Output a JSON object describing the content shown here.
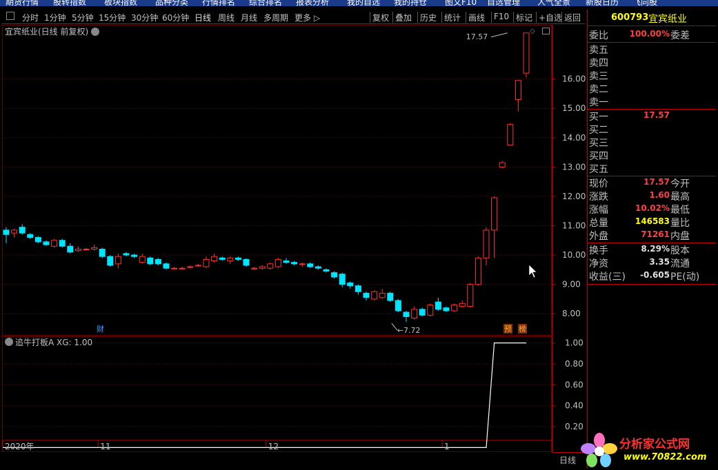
{
  "menubar": [
    "期货行情",
    "股转指数",
    "板块指数",
    "品种分类",
    "行情排名",
    "综合排名",
    "报表分析",
    "我的自选",
    "我的持仓",
    "图文F10",
    "自选管理",
    "人气全景",
    "新股日历",
    "飞向股"
  ],
  "toolbar": {
    "periods": [
      "分时",
      "1分钟",
      "5分钟",
      "15分钟",
      "30分钟",
      "60分钟",
      "日线",
      "周线",
      "月线",
      "多周期",
      "更多 ▷"
    ],
    "active_period": "日线",
    "right_buttons": [
      "复权",
      "叠加",
      "历史",
      "统计",
      "画线",
      "F10",
      "标记",
      "+自选",
      "返回"
    ]
  },
  "chart_title": "宜宾纸业(日线 前复权)",
  "indicator_title": "追牛打板A XG: 1.00",
  "bottom_period": "日线",
  "markers": {
    "cai": "财",
    "yu": "预",
    "bang": "榜"
  },
  "chart_data": [
    {
      "type": "candlestick",
      "title": "宜宾纸业(日线 前复权)",
      "y_ticks": [
        8.0,
        9.0,
        10.0,
        11.0,
        12.0,
        13.0,
        14.0,
        15.0,
        16.0
      ],
      "ylim": [
        7.3,
        17.8
      ],
      "x_labels": [
        {
          "label": "2020年",
          "index": 0
        },
        {
          "label": "11",
          "index": 12
        },
        {
          "label": "12",
          "index": 33
        },
        {
          "label": "1",
          "index": 55
        }
      ],
      "annotations": [
        {
          "text": "17.57",
          "index": 63,
          "value": 17.57
        },
        {
          "text": "7.72",
          "index": 48,
          "value": 7.72
        }
      ],
      "candles": [
        [
          10.85,
          10.95,
          10.4,
          10.7
        ],
        [
          10.75,
          10.9,
          10.6,
          10.85
        ],
        [
          10.95,
          11.05,
          10.7,
          10.75
        ],
        [
          10.7,
          10.75,
          10.55,
          10.6
        ],
        [
          10.6,
          10.65,
          10.4,
          10.45
        ],
        [
          10.45,
          10.5,
          10.3,
          10.35
        ],
        [
          10.3,
          10.55,
          10.25,
          10.5
        ],
        [
          10.5,
          10.55,
          10.25,
          10.3
        ],
        [
          10.3,
          10.4,
          10.05,
          10.1
        ],
        [
          10.15,
          10.3,
          10.1,
          10.2
        ],
        [
          10.2,
          10.25,
          10.15,
          10.2
        ],
        [
          10.2,
          10.35,
          10.15,
          10.25
        ],
        [
          10.2,
          10.25,
          9.9,
          9.95
        ],
        [
          9.95,
          10.0,
          9.6,
          9.65
        ],
        [
          9.7,
          10.05,
          9.55,
          9.95
        ],
        [
          10.05,
          10.1,
          9.95,
          10.0
        ],
        [
          10.0,
          10.05,
          9.9,
          9.95
        ],
        [
          9.75,
          10.05,
          9.7,
          9.95
        ],
        [
          9.9,
          9.95,
          9.65,
          9.7
        ],
        [
          9.85,
          9.9,
          9.65,
          9.7
        ],
        [
          9.7,
          9.75,
          9.5,
          9.55
        ],
        [
          9.55,
          9.6,
          9.5,
          9.55
        ],
        [
          9.55,
          9.6,
          9.5,
          9.55
        ],
        [
          9.6,
          9.65,
          9.55,
          9.6
        ],
        [
          9.65,
          9.7,
          9.6,
          9.65
        ],
        [
          9.6,
          9.95,
          9.55,
          9.85
        ],
        [
          9.8,
          10.05,
          9.75,
          9.95
        ],
        [
          9.9,
          9.95,
          9.8,
          9.85
        ],
        [
          9.8,
          9.95,
          9.7,
          9.9
        ],
        [
          9.9,
          9.95,
          9.8,
          9.85
        ],
        [
          9.85,
          9.9,
          9.6,
          9.65
        ],
        [
          9.55,
          9.6,
          9.5,
          9.55
        ],
        [
          9.55,
          9.65,
          9.5,
          9.6
        ],
        [
          9.55,
          9.75,
          9.5,
          9.7
        ],
        [
          9.6,
          9.9,
          9.55,
          9.85
        ],
        [
          9.8,
          9.9,
          9.7,
          9.75
        ],
        [
          9.75,
          9.8,
          9.65,
          9.7
        ],
        [
          9.7,
          9.75,
          9.6,
          9.7
        ],
        [
          9.7,
          9.75,
          9.55,
          9.6
        ],
        [
          9.6,
          9.65,
          9.5,
          9.55
        ],
        [
          9.5,
          9.55,
          9.4,
          9.45
        ],
        [
          9.4,
          9.45,
          9.2,
          9.25
        ],
        [
          9.35,
          9.4,
          8.9,
          9.0
        ],
        [
          9.05,
          9.1,
          8.85,
          8.95
        ],
        [
          8.95,
          9.0,
          8.65,
          8.75
        ],
        [
          8.7,
          8.75,
          8.45,
          8.55
        ],
        [
          8.5,
          8.8,
          8.45,
          8.75
        ],
        [
          8.55,
          8.85,
          8.5,
          8.7
        ],
        [
          8.7,
          8.75,
          8.4,
          8.45
        ],
        [
          8.45,
          8.5,
          8.05,
          8.1
        ],
        [
          8.05,
          8.1,
          7.72,
          7.9
        ],
        [
          7.85,
          8.25,
          7.8,
          8.15
        ],
        [
          8.15,
          8.2,
          7.9,
          7.95
        ],
        [
          7.95,
          8.35,
          7.9,
          8.3
        ],
        [
          8.4,
          8.55,
          8.1,
          8.15
        ],
        [
          8.2,
          8.25,
          8.05,
          8.1
        ],
        [
          8.1,
          8.35,
          8.05,
          8.3
        ],
        [
          8.25,
          8.45,
          8.2,
          8.35
        ],
        [
          8.25,
          9.05,
          8.2,
          9.0
        ],
        [
          9.0,
          9.95,
          8.95,
          9.9
        ],
        [
          9.9,
          10.95,
          9.65,
          10.85
        ],
        [
          10.85,
          12.0,
          9.9,
          11.95
        ],
        [
          13.0,
          13.2,
          12.95,
          13.15
        ],
        [
          13.75,
          14.5,
          13.75,
          14.45
        ],
        [
          15.3,
          15.95,
          14.9,
          15.95
        ],
        [
          16.2,
          17.57,
          16.05,
          17.57
        ]
      ]
    },
    {
      "type": "line",
      "title": "追牛打板A XG: 1.00",
      "y_ticks": [
        0.2,
        0.4,
        0.6,
        0.8,
        1.0
      ],
      "ylim": [
        -0.03,
        1.05
      ],
      "values": [
        0,
        0,
        0,
        0,
        0,
        0,
        0,
        0,
        0,
        0,
        0,
        0,
        0,
        0,
        0,
        0,
        0,
        0,
        0,
        0,
        0,
        0,
        0,
        0,
        0,
        0,
        0,
        0,
        0,
        0,
        0,
        0,
        0,
        0,
        0,
        0,
        0,
        0,
        0,
        0,
        0,
        0,
        0,
        0,
        0,
        0,
        0,
        0,
        0,
        0,
        0,
        0,
        0,
        0,
        0,
        0,
        0,
        0,
        0,
        0,
        0,
        1,
        1,
        1,
        1,
        1
      ]
    }
  ],
  "quote": {
    "code": "600793",
    "name": "宜宾纸业",
    "weibi": {
      "label": "委比",
      "value": "100.00%",
      "label2": "委差"
    },
    "sell": [
      "卖五",
      "卖四",
      "卖三",
      "卖二",
      "卖一"
    ],
    "buy": [
      {
        "label": "买一",
        "value": "17.57"
      },
      {
        "label": "买二",
        "value": ""
      },
      {
        "label": "买三",
        "value": ""
      },
      {
        "label": "买四",
        "value": ""
      },
      {
        "label": "买五",
        "value": ""
      }
    ],
    "stats": [
      {
        "label": "现价",
        "value": "17.57",
        "label2": "今开",
        "color": "#ff4040"
      },
      {
        "label": "涨跌",
        "value": "1.60",
        "label2": "最高",
        "color": "#ff4040"
      },
      {
        "label": "涨幅",
        "value": "10.02%",
        "label2": "最低",
        "color": "#ff4040"
      },
      {
        "label": "总量",
        "value": "146583",
        "label2": "量比",
        "color": "#ffff00"
      },
      {
        "label": "外盘",
        "value": "71261",
        "label2": "内盘",
        "color": "#ff4040"
      }
    ],
    "fin": [
      {
        "label": "换手",
        "value": "8.29%",
        "label2": "股本"
      },
      {
        "label": "净资",
        "value": "3.35",
        "label2": "流通"
      },
      {
        "label": "收益(三)",
        "value": "-0.605",
        "label2": "PE(动)"
      }
    ]
  },
  "watermark": {
    "text": "分析家公式网",
    "url": "www.70822.com"
  },
  "colors": {
    "up": "#ff3030",
    "down": "#00e5ff",
    "grid": "#800000",
    "axis": "#c00000"
  }
}
